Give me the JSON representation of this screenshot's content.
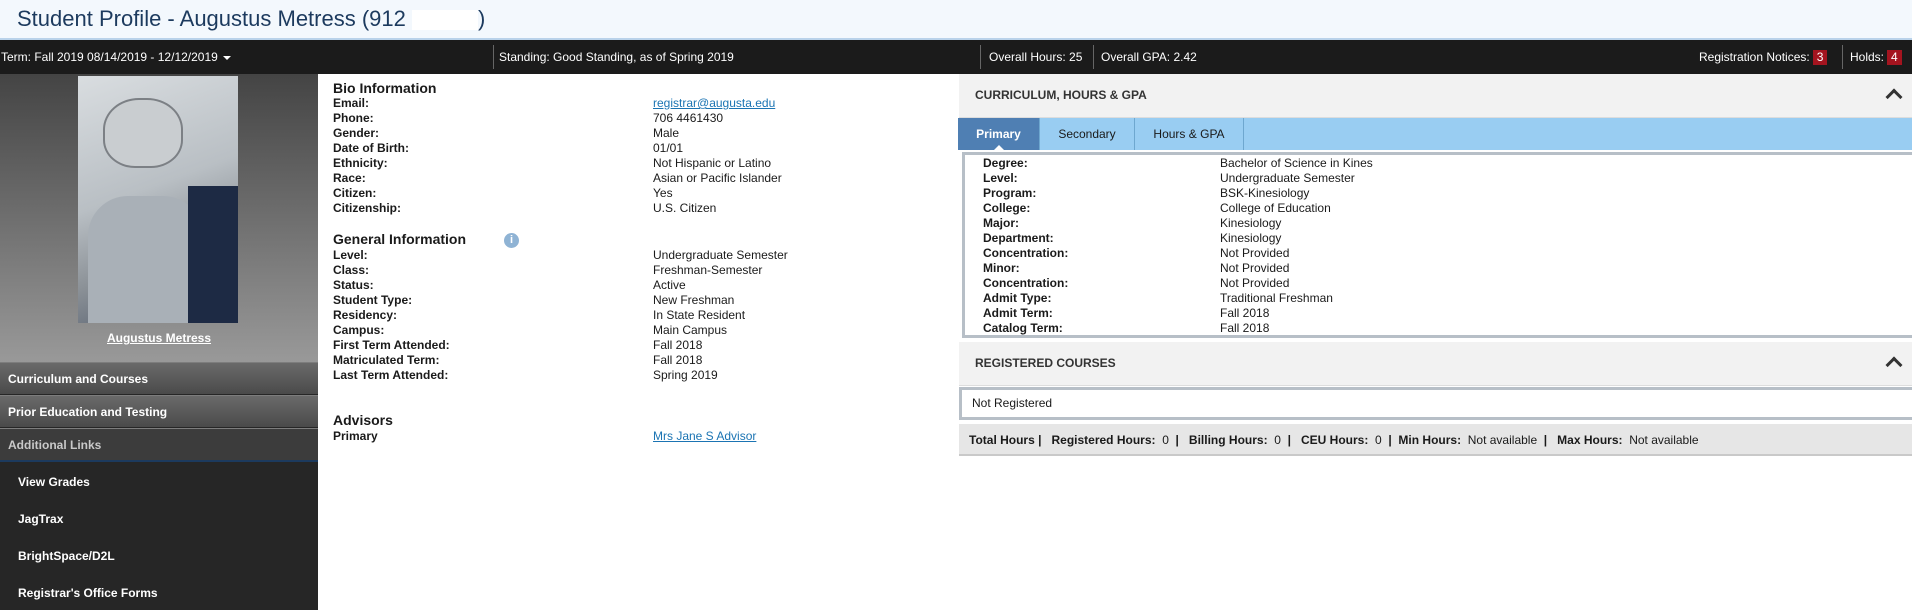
{
  "header": {
    "title": "Student Profile - Augustus Metress (912",
    "title_end": ")"
  },
  "infobar": {
    "term": "Term: Fall 2019 08/14/2019 - 12/12/2019",
    "standing": "Standing: Good Standing, as of Spring 2019",
    "overall_hours": "Overall Hours: 25",
    "overall_gpa": "Overall GPA: 2.42",
    "registration_notices_label": "Registration Notices:",
    "registration_notices_count": "3",
    "holds_label": "Holds:",
    "holds_count": "4"
  },
  "sidebar": {
    "student_name": "Augustus Metress",
    "nav": [
      "Curriculum and Courses",
      "Prior Education and Testing",
      "Additional Links"
    ],
    "links": [
      "View Grades",
      "JagTrax",
      "BrightSpace/D2L",
      "Registrar's Office Forms"
    ]
  },
  "bio": {
    "title": "Bio Information",
    "rows": [
      {
        "k": "Email:",
        "v": "registrar@augusta.edu"
      },
      {
        "k": "Phone:",
        "v": "706 4461430"
      },
      {
        "k": "Gender:",
        "v": "Male"
      },
      {
        "k": "Date of Birth:",
        "v": "01/01"
      },
      {
        "k": "Ethnicity:",
        "v": "Not Hispanic or Latino"
      },
      {
        "k": "Race:",
        "v": "Asian or Pacific Islander"
      },
      {
        "k": "Citizen:",
        "v": "Yes"
      },
      {
        "k": "Citizenship:",
        "v": "U.S. Citizen"
      }
    ]
  },
  "general": {
    "title": "General Information",
    "info_icon": "i",
    "rows": [
      {
        "k": "Level:",
        "v": "Undergraduate Semester"
      },
      {
        "k": "Class:",
        "v": "Freshman-Semester"
      },
      {
        "k": "Status:",
        "v": "Active"
      },
      {
        "k": "Student Type:",
        "v": "New Freshman"
      },
      {
        "k": "Residency:",
        "v": "In State Resident"
      },
      {
        "k": "Campus:",
        "v": "Main Campus"
      },
      {
        "k": "First Term Attended:",
        "v": "Fall 2018"
      },
      {
        "k": "Matriculated Term:",
        "v": "Fall 2018"
      },
      {
        "k": "Last Term Attended:",
        "v": "Spring 2019"
      }
    ]
  },
  "advisors": {
    "title": "Advisors",
    "rows": [
      {
        "k": "Primary",
        "v": "Mrs Jane S Advisor"
      }
    ]
  },
  "curriculum": {
    "title": "CURRICULUM, HOURS & GPA",
    "tabs": [
      "Primary",
      "Secondary",
      "Hours & GPA"
    ],
    "rows": [
      {
        "k": "Degree:",
        "v": "Bachelor of Science in Kines"
      },
      {
        "k": "Level:",
        "v": "Undergraduate Semester"
      },
      {
        "k": "Program:",
        "v": "BSK-Kinesiology"
      },
      {
        "k": "College:",
        "v": "College of Education"
      },
      {
        "k": "Major:",
        "v": "Kinesiology"
      },
      {
        "k": "Department:",
        "v": "Kinesiology"
      },
      {
        "k": "Concentration:",
        "v": "Not Provided"
      },
      {
        "k": "Minor:",
        "v": "Not Provided"
      },
      {
        "k": "Concentration:",
        "v": "Not Provided"
      },
      {
        "k": "Admit Type:",
        "v": "Traditional Freshman"
      },
      {
        "k": "Admit Term:",
        "v": "Fall 2018"
      },
      {
        "k": "Catalog Term:",
        "v": "Fall 2018"
      }
    ]
  },
  "registered": {
    "title": "REGISTERED COURSES",
    "status": "Not Registered",
    "totals": {
      "total_hours": "Total Hours |",
      "registered_label": "Registered Hours:",
      "registered_value": "0",
      "billing_label": "Billing Hours:",
      "billing_value": "0",
      "ceu_label": "CEU Hours:",
      "ceu_value": "0",
      "min_label": "Min Hours:",
      "min_value": "Not available",
      "max_label": "Max Hours:",
      "max_value": "Not available"
    }
  },
  "colors": {
    "badge": "#a4141f",
    "tab_active": "#4f7fb3",
    "tab_bar": "#99cdf2",
    "link": "#1b74b3"
  }
}
